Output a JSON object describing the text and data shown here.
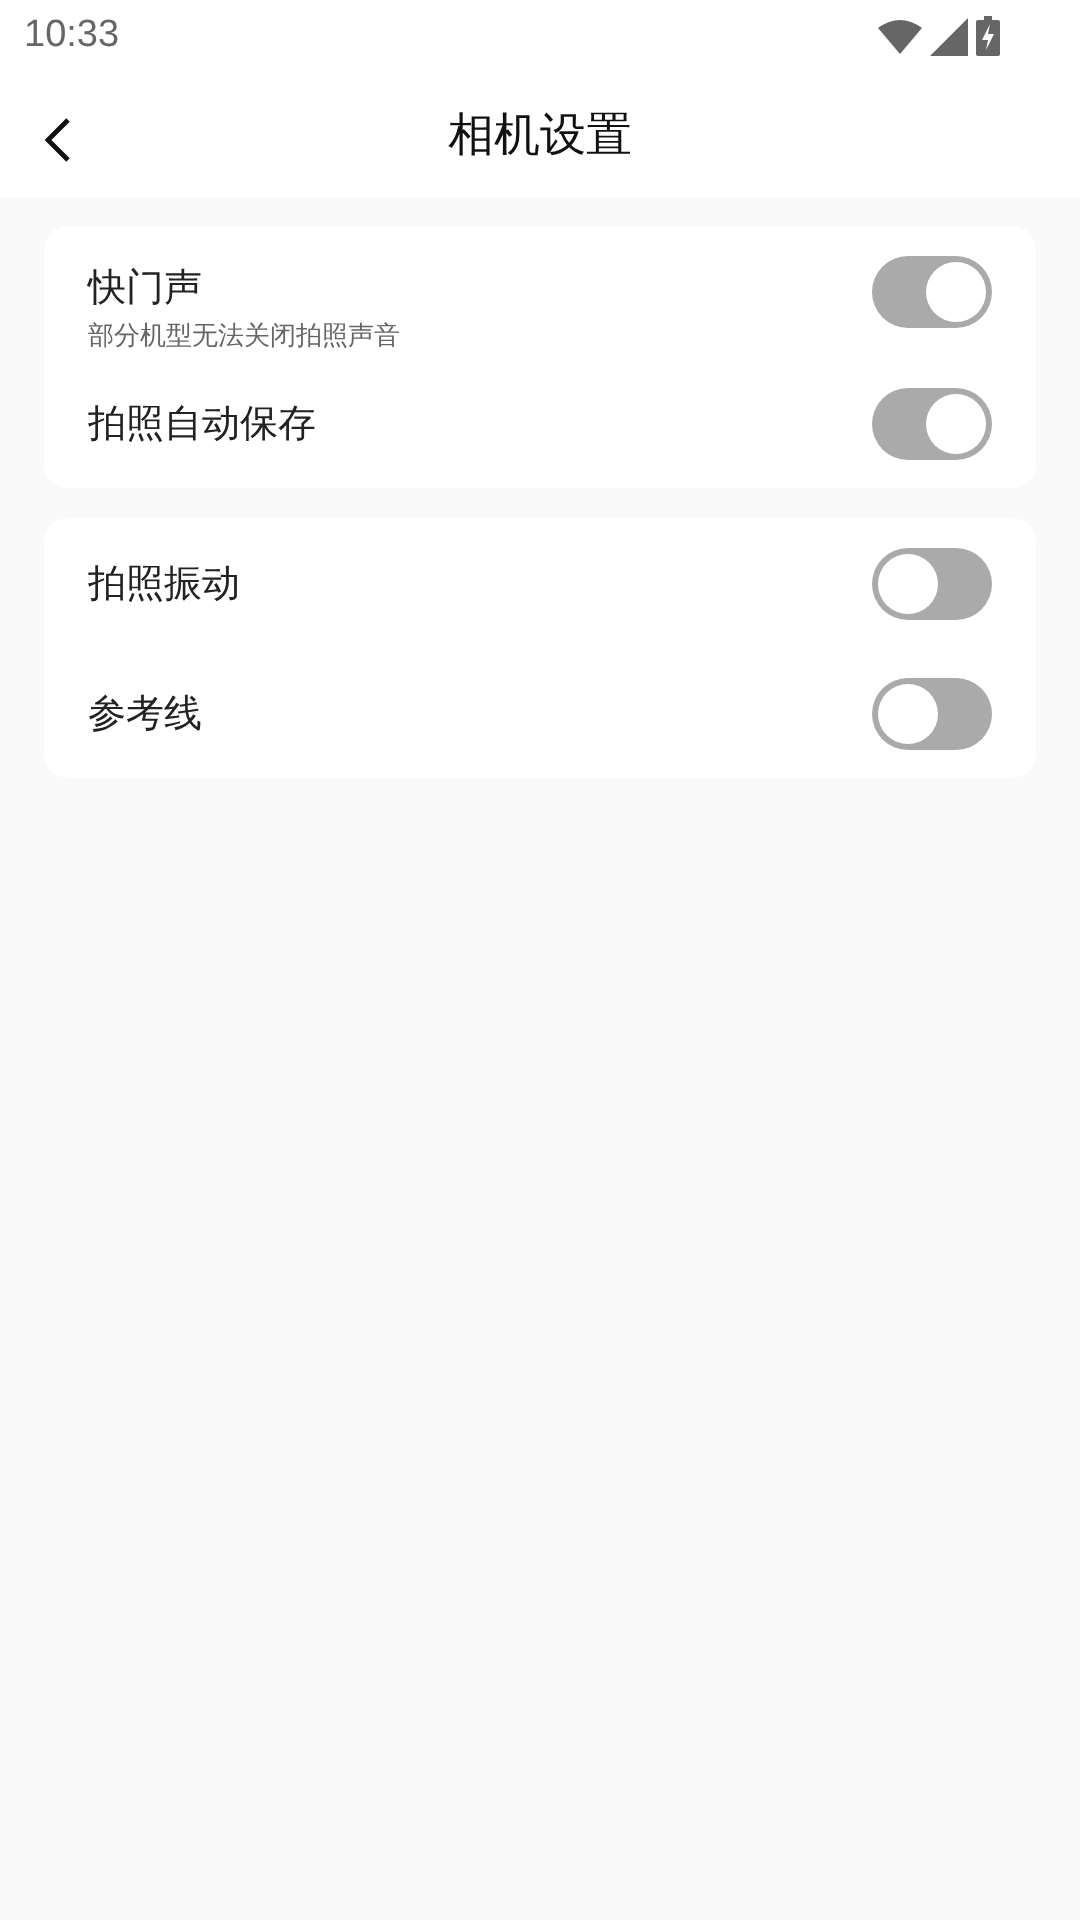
{
  "status_bar": {
    "time": "10:33"
  },
  "header": {
    "title": "相机设置"
  },
  "groups": [
    {
      "items": [
        {
          "label": "快门声",
          "subtitle": "部分机型无法关闭拍照声音",
          "on": true
        },
        {
          "label": "拍照自动保存",
          "on": true
        }
      ]
    },
    {
      "items": [
        {
          "label": "拍照振动",
          "on": false
        },
        {
          "label": "参考线",
          "on": false
        }
      ]
    }
  ]
}
